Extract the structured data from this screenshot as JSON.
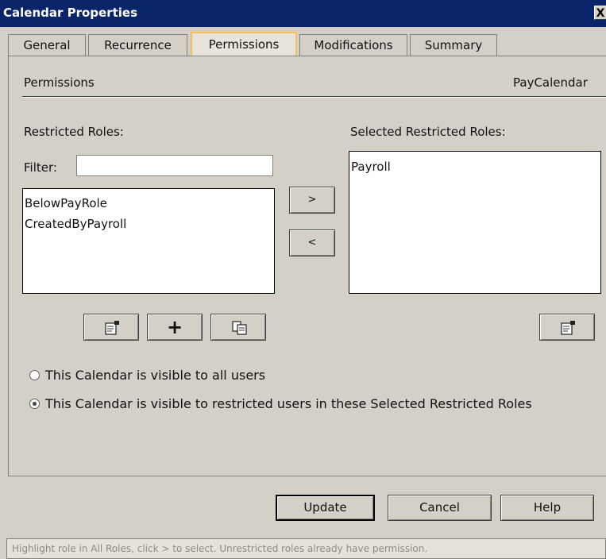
{
  "window": {
    "title": "Calendar Properties",
    "close_label": "X"
  },
  "tabs": [
    {
      "label": "General",
      "active": false
    },
    {
      "label": "Recurrence",
      "active": false
    },
    {
      "label": "Permissions",
      "active": true
    },
    {
      "label": "Modifications",
      "active": false
    },
    {
      "label": "Summary",
      "active": false
    }
  ],
  "section": {
    "heading": "Permissions",
    "calendar_name": "PayCalendar"
  },
  "restricted_roles": {
    "label": "Restricted Roles:",
    "filter_label": "Filter:",
    "filter_value": "",
    "items": [
      "BelowPayRole",
      "CreatedByPayroll"
    ]
  },
  "selected_roles": {
    "label": "Selected Restricted Roles:",
    "items": [
      "Payroll"
    ]
  },
  "move_buttons": {
    "add": ">",
    "remove": "<"
  },
  "icon_buttons": {
    "left": [
      {
        "icon": "properties-icon"
      },
      {
        "icon": "plus-icon",
        "glyph": "+"
      },
      {
        "icon": "copy-icon"
      }
    ],
    "right": [
      {
        "icon": "properties-icon"
      }
    ]
  },
  "visibility": {
    "options": [
      {
        "label": "This Calendar is visible to all users",
        "selected": false
      },
      {
        "label": "This Calendar is visible to restricted users in these Selected Restricted Roles",
        "selected": true
      }
    ]
  },
  "footer": {
    "update": "Update",
    "cancel": "Cancel",
    "help": "Help"
  },
  "status": {
    "text": "Highlight role in All Roles, click > to select. Unrestricted roles already have permission."
  },
  "colors": {
    "titlebar": "#0a246a",
    "dialog_bg": "#d4d0c8",
    "active_tab_border": "#f0c060"
  }
}
